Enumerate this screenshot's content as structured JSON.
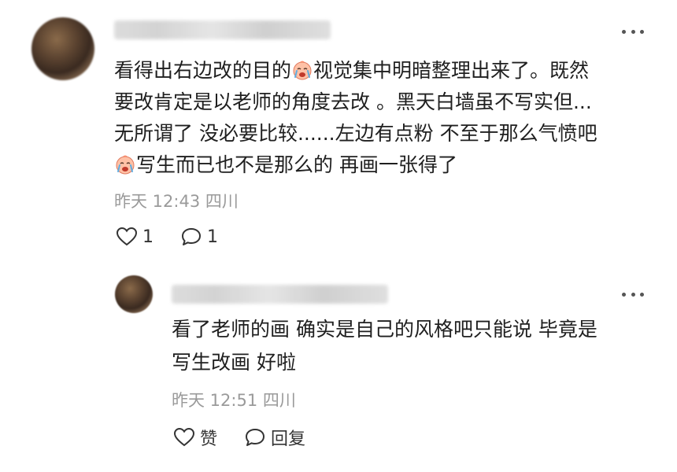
{
  "comment": {
    "lines": [
      "看得出右边改的目的",
      "视觉集中明暗整理出来了。既然",
      "要改肯定是以老师的角度去改 。黑天白墙虽不写实但...",
      "无所谓了 没必要比较......左边有点粉 不至于那么气愤吧",
      "写生而已也不是那么的 再画一张得了"
    ],
    "meta": "昨天 12:43 四川",
    "like_count": "1",
    "reply_count": "1",
    "emoji_icon": "crying-face-emoji-icon"
  },
  "reply": {
    "lines": [
      "看了老师的画 确实是自己的风格吧只能说 毕竟是",
      "写生改画 好啦"
    ],
    "meta": "昨天 12:51 四川",
    "like_label": "赞",
    "reply_label": "回复"
  },
  "colors": {
    "text": "#1f1f1f",
    "meta": "#9a9a9a",
    "icon": "#333333"
  }
}
